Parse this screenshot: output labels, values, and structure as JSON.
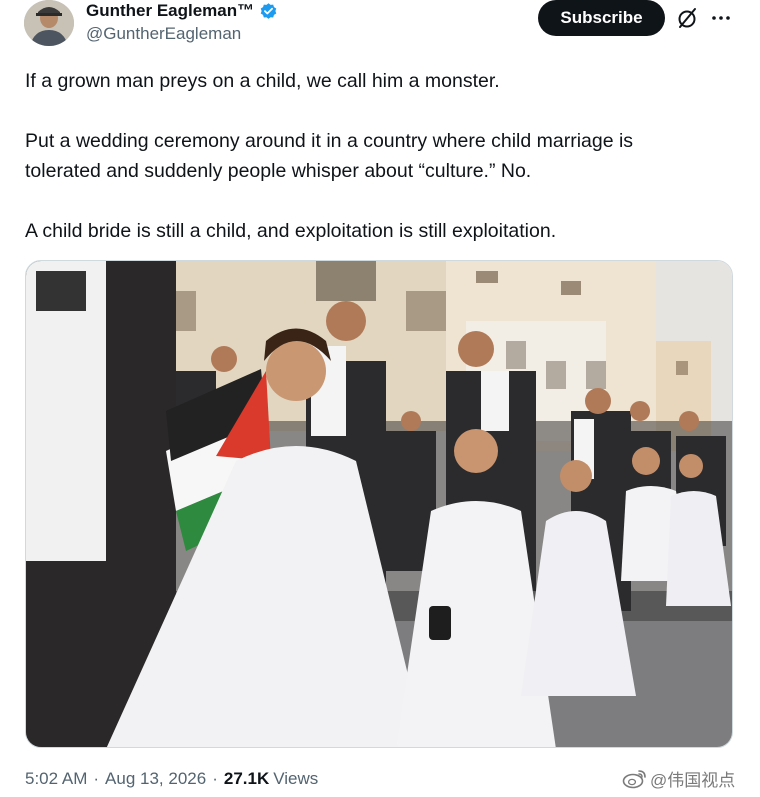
{
  "author": {
    "display_name": "Gunther Eagleman™",
    "handle": "@GuntherEagleman",
    "avatar_icon": "profile-photo-avatar",
    "verified_icon": "verified-badge-icon",
    "verified_color": "#1d9bf0"
  },
  "actions": {
    "subscribe_label": "Subscribe",
    "grok_icon": "grok-icon",
    "more_icon": "more-options-icon"
  },
  "tweet": {
    "line1": "If a grown man preys on a child, we call him a monster.",
    "line2": "Put a wedding ceremony around it in a country where child marriage is",
    "line3": "tolerated and suddenly people whisper about “culture.” No.",
    "line4": "A child bride is still a child, and exploitation is still exploitation."
  },
  "meta": {
    "time": "5:02 AM",
    "separator": "·",
    "date": "Aug 13, 2026",
    "views_count": "27.1K",
    "views_label": "Views"
  },
  "watermark": {
    "text": "@伟国视点",
    "icon": "weibo-icon"
  },
  "colors": {
    "text_primary": "#0f1419",
    "text_secondary": "#536471",
    "button_bg": "#0f1419",
    "border": "#cfd9de"
  }
}
